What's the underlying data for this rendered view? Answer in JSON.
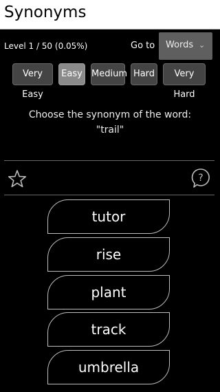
{
  "header": {
    "title": "Synonyms"
  },
  "level": {
    "text": "Level 1 / 50 (0.05%)"
  },
  "goto": {
    "label": "Go to",
    "selected": "Words"
  },
  "difficulty": {
    "options": [
      "Very Easy",
      "Easy",
      "Medium",
      "Hard",
      "Very Hard"
    ],
    "selected": "Easy"
  },
  "question": {
    "prompt": "Choose the synonym of the word:",
    "word": "\"trail\""
  },
  "icons": {
    "favorite": "star-outline-icon",
    "help": "question-bubble-icon"
  },
  "answers": [
    "tutor",
    "rise",
    "plant",
    "track",
    "umbrella"
  ],
  "colors": {
    "background": "#000000",
    "header_bg": "#ffffff",
    "button_bg": "#444444",
    "selected_button_bg": "#8a8a8a",
    "select_bg": "#5f5f5f"
  }
}
